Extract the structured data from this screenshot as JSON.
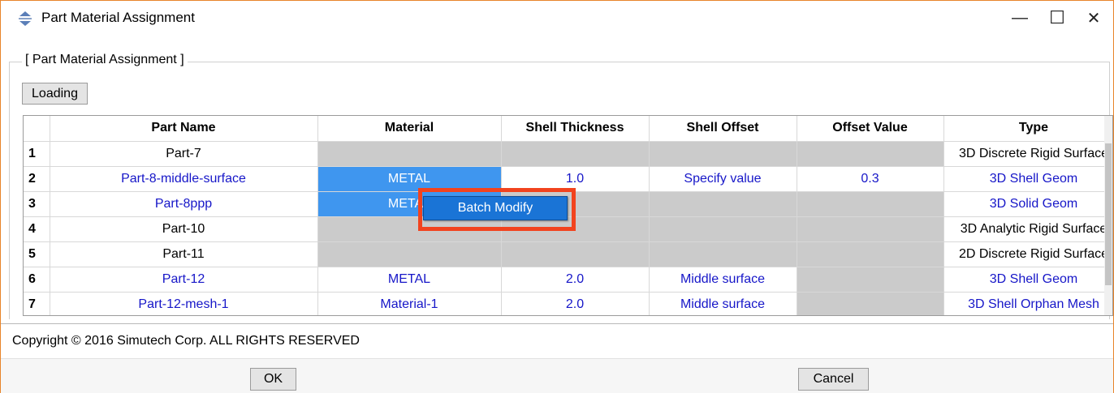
{
  "window": {
    "title": "Part Material Assignment",
    "controls": {
      "minimize": "—",
      "maximize": "☐",
      "close": "✕"
    }
  },
  "group": {
    "label": "[ Part Material Assignment ]"
  },
  "toolbar": {
    "loading_label": "Loading"
  },
  "table": {
    "columns": [
      "",
      "Part Name",
      "Material",
      "Shell Thickness",
      "Shell Offset",
      "Offset Value",
      "Type"
    ],
    "rows": [
      {
        "num": "1",
        "part": "Part-7",
        "material": "",
        "thickness": "",
        "offset": "",
        "offset_value": "",
        "type": "3D Discrete Rigid Surface",
        "color": "black",
        "material_state": "gray",
        "thickness_state": "gray",
        "offset_state": "gray",
        "value_state": "gray"
      },
      {
        "num": "2",
        "part": "Part-8-middle-surface",
        "material": "METAL",
        "thickness": "1.0",
        "offset": "Specify value",
        "offset_value": "0.3",
        "type": "3D Shell Geom",
        "color": "blue",
        "material_state": "selected",
        "thickness_state": "normal",
        "offset_state": "normal",
        "value_state": "normal"
      },
      {
        "num": "3",
        "part": "Part-8ppp",
        "material": "METAL",
        "thickness": "",
        "offset": "",
        "offset_value": "",
        "type": "3D Solid Geom",
        "color": "blue",
        "material_state": "selected",
        "thickness_state": "gray",
        "offset_state": "gray",
        "value_state": "gray"
      },
      {
        "num": "4",
        "part": "Part-10",
        "material": "",
        "thickness": "",
        "offset": "",
        "offset_value": "",
        "type": "3D Analytic Rigid Surface",
        "color": "black",
        "material_state": "gray",
        "thickness_state": "gray",
        "offset_state": "gray",
        "value_state": "gray"
      },
      {
        "num": "5",
        "part": "Part-11",
        "material": "",
        "thickness": "",
        "offset": "",
        "offset_value": "",
        "type": "2D Discrete Rigid Surface",
        "color": "black",
        "material_state": "gray",
        "thickness_state": "gray",
        "offset_state": "gray",
        "value_state": "gray"
      },
      {
        "num": "6",
        "part": "Part-12",
        "material": "METAL",
        "thickness": "2.0",
        "offset": "Middle surface",
        "offset_value": "",
        "type": "3D Shell Geom",
        "color": "blue",
        "material_state": "normal",
        "thickness_state": "normal",
        "offset_state": "normal",
        "value_state": "gray"
      },
      {
        "num": "7",
        "part": "Part-12-mesh-1",
        "material": "Material-1",
        "thickness": "2.0",
        "offset": "Middle surface",
        "offset_value": "",
        "type": "3D Shell Orphan Mesh",
        "color": "blue",
        "material_state": "normal",
        "thickness_state": "normal",
        "offset_state": "normal",
        "value_state": "gray"
      }
    ]
  },
  "context_menu": {
    "item": "Batch Modify",
    "highlight_color": "#f2431e"
  },
  "footer": {
    "copyright": "Copyright © 2016 Simutech Corp.  ALL RIGHTS RESERVED",
    "ok_label": "OK",
    "cancel_label": "Cancel"
  },
  "colors": {
    "link_text": "#1616c8",
    "selected_cell": "#3f96ef",
    "disabled_cell": "#cbcbcb",
    "window_border": "#e8842a"
  },
  "icons": {
    "app": "part-material-app-icon"
  }
}
